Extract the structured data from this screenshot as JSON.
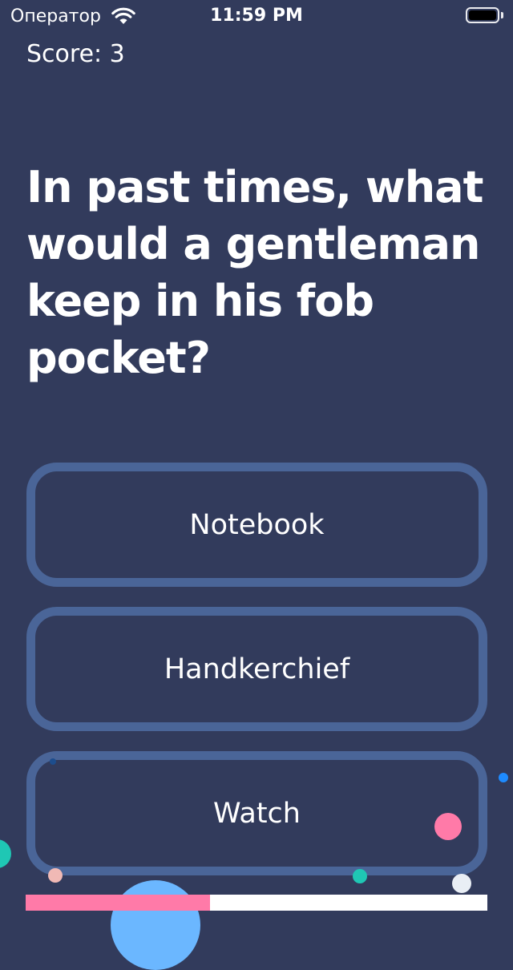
{
  "status_bar": {
    "carrier": "Оператор",
    "time": "11:59 PM",
    "icons": [
      "wifi-icon",
      "battery-icon"
    ]
  },
  "score": {
    "label": "Score: 3"
  },
  "question": {
    "text": "In past times, what would a gentleman keep in his fob pocket?"
  },
  "answers": [
    {
      "label": "Notebook"
    },
    {
      "label": "Handkerchief"
    },
    {
      "label": "Watch"
    }
  ],
  "progress": {
    "fraction": 0.4
  },
  "colors": {
    "background": "#323b5c",
    "answer_border": "#4a6598",
    "progress_fill": "#ff7aa8",
    "progress_track": "#ffffff",
    "confetti": [
      "#ff7aa8",
      "#1fc7b4",
      "#f0b9b5",
      "#1d4d8d",
      "#1e8bff",
      "#6bb7ff",
      "#e9eef5"
    ]
  }
}
